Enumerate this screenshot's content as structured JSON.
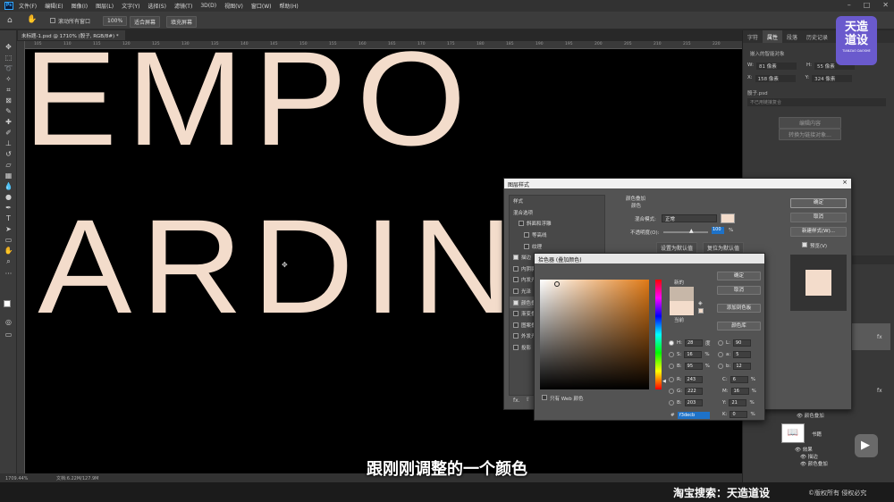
{
  "menu": {
    "logo": "Ps",
    "items": [
      "文件(F)",
      "编辑(E)",
      "图像(I)",
      "图层(L)",
      "文字(Y)",
      "选择(S)",
      "滤镜(T)",
      "3D(D)",
      "视图(V)",
      "窗口(W)",
      "帮助(H)"
    ]
  },
  "options": {
    "scroll_all": "滚动所有窗口",
    "zoom": "100%",
    "fit_screen": "适合屏幕",
    "fill_screen": "填充屏幕"
  },
  "document": {
    "tab": "未标题-1.psd @ 1710% (骰子, RGB/8#) *",
    "ruler_ticks": [
      "105",
      "110",
      "115",
      "120",
      "125",
      "130",
      "135",
      "140",
      "145",
      "150",
      "155",
      "160",
      "165",
      "170",
      "175",
      "180",
      "185",
      "190",
      "195",
      "200",
      "205",
      "210",
      "215",
      "220"
    ],
    "line1": "EMPO",
    "line2": "IARDIN",
    "colors": {
      "text": "#f3dccb",
      "background": "#000000"
    }
  },
  "status": {
    "zoom": "1709.44%",
    "doc": "文档:6.22M/127.9M"
  },
  "right_panel": {
    "tabs": [
      "字符",
      "属性",
      "段落",
      "历史记录"
    ],
    "doc_label": "嵌入的智能对象",
    "w_label": "W:",
    "w_value": "81 像素",
    "h_label": "H:",
    "h_value": "55 像素",
    "x_label": "X:",
    "x_value": "158 像素",
    "y_label": "Y:",
    "y_value": "324 像素",
    "file": "骰子.psd",
    "link": "不已用链接复合",
    "edit_btn": "编辑内容",
    "convert_btn": "转换为链接对象...",
    "layers": [
      {
        "name": "颜色叠加"
      },
      {
        "name": "书籍"
      },
      {
        "name": "效果"
      },
      {
        "name": "描边"
      },
      {
        "name": "颜色叠加"
      }
    ]
  },
  "layer_style": {
    "title": "图层样式",
    "close": "×",
    "fx_items": [
      {
        "label": "样式",
        "check": false,
        "on": false,
        "plus": false
      },
      {
        "label": "混合选项",
        "check": false,
        "on": false,
        "plus": false
      },
      {
        "label": "斜面和浮雕",
        "check": true,
        "on": false,
        "plus": false
      },
      {
        "label": "等高线",
        "check": true,
        "on": false,
        "plus": false
      },
      {
        "label": "纹理",
        "check": true,
        "on": false,
        "plus": false
      },
      {
        "label": "描边",
        "check": true,
        "on": true,
        "plus": true
      },
      {
        "label": "内阴影",
        "check": true,
        "on": false,
        "plus": true
      },
      {
        "label": "内发光",
        "check": true,
        "on": false,
        "plus": false
      },
      {
        "label": "光泽",
        "check": true,
        "on": false,
        "plus": false
      },
      {
        "label": "颜色叠加",
        "check": true,
        "on": true,
        "plus": true
      },
      {
        "label": "渐变叠加",
        "check": true,
        "on": false,
        "plus": true
      },
      {
        "label": "图案叠加",
        "check": true,
        "on": false,
        "plus": false
      },
      {
        "label": "外发光",
        "check": true,
        "on": false,
        "plus": false
      },
      {
        "label": "投影",
        "check": true,
        "on": false,
        "plus": true
      }
    ],
    "fx_footer": "fx.",
    "section": "颜色叠加",
    "subsection": "颜色",
    "blend_label": "混合模式:",
    "blend_value": "正常",
    "opacity_label": "不透明度(O):",
    "opacity_value": "100",
    "opacity_unit": "%",
    "overlay_color": "#f3dccb",
    "set_default": "设置为默认值",
    "reset_default": "复位为默认值",
    "buttons": {
      "ok": "确定",
      "cancel": "取消",
      "new_style": "新建样式(W)...",
      "preview": "预览(V)"
    }
  },
  "color_picker": {
    "title": "拾色器 (叠加颜色)",
    "new_label": "新的",
    "current_label": "当前",
    "new_color": "#c7b7a8",
    "current_color": "#f3dccb",
    "buttons": {
      "ok": "确定",
      "cancel": "取消",
      "add_swatch": "添加到色板",
      "libraries": "颜色库"
    },
    "web_only": "只有 Web 颜色",
    "fields": {
      "H": "28",
      "H_unit": "度",
      "S": "16",
      "S_unit": "%",
      "B": "95",
      "B_unit": "%",
      "R": "243",
      "G": "222",
      "B2": "203",
      "L": "90",
      "a": "5",
      "b": "12",
      "C": "6",
      "M": "16",
      "Y": "21",
      "K": "0",
      "pct": "%",
      "hex_label": "#",
      "hex": "f3decb"
    },
    "labels": {
      "H": "H:",
      "S": "S:",
      "B": "B:",
      "R": "R:",
      "G": "G:",
      "Bb": "B:",
      "L": "L:",
      "a": "a:",
      "b": "b:",
      "C": "C:",
      "M": "M:",
      "Y": "Y:",
      "K": "K:"
    }
  },
  "overlay": {
    "subtitle": "跟刚刚调整的一个颜色",
    "taobao": "淘宝搜索：天造道设",
    "copyright": "©版权所有 侵权必究",
    "logo_line1": "天造",
    "logo_line2": "道设",
    "logo_small": "TIANZAO DAOSHE"
  }
}
